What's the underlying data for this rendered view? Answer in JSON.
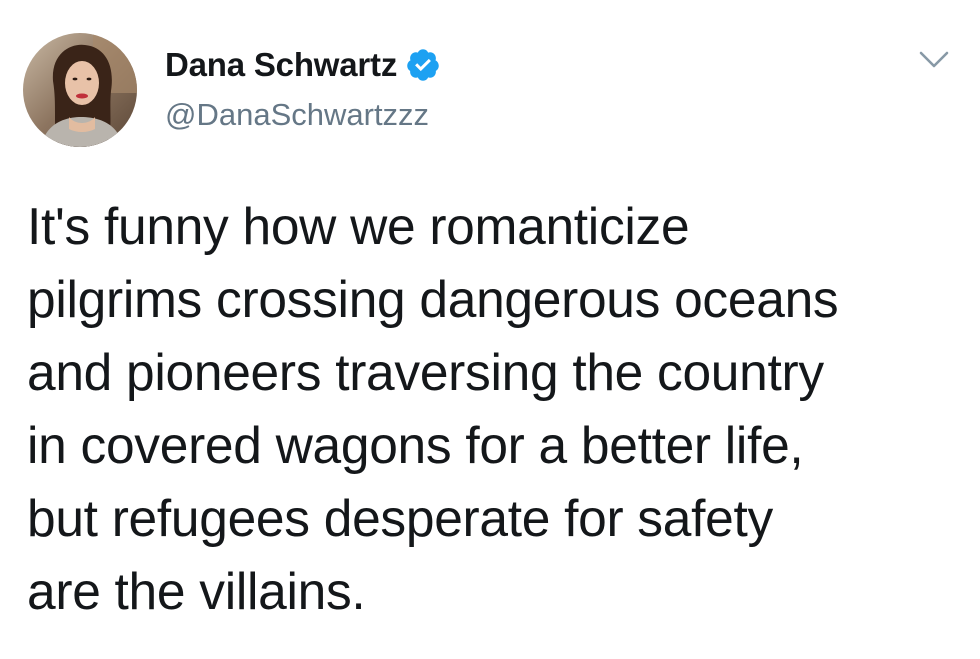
{
  "user": {
    "display_name": "Dana Schwartz",
    "handle": "@DanaSchwartzzz",
    "verified": true,
    "avatar_icon": "profile-photo"
  },
  "menu": {
    "icon": "chevron-down-icon"
  },
  "tweet": {
    "lines": [
      "It's funny how we romanticize",
      "pilgrims crossing dangerous oceans",
      "and pioneers traversing the country",
      "in covered wagons for a better life,",
      "but refugees desperate for safety",
      "are the villains."
    ]
  },
  "colors": {
    "text": "#14171a",
    "secondary": "#657786",
    "verified_badge": "#1da1f2",
    "chevron": "#8899a6",
    "background": "#ffffff"
  }
}
